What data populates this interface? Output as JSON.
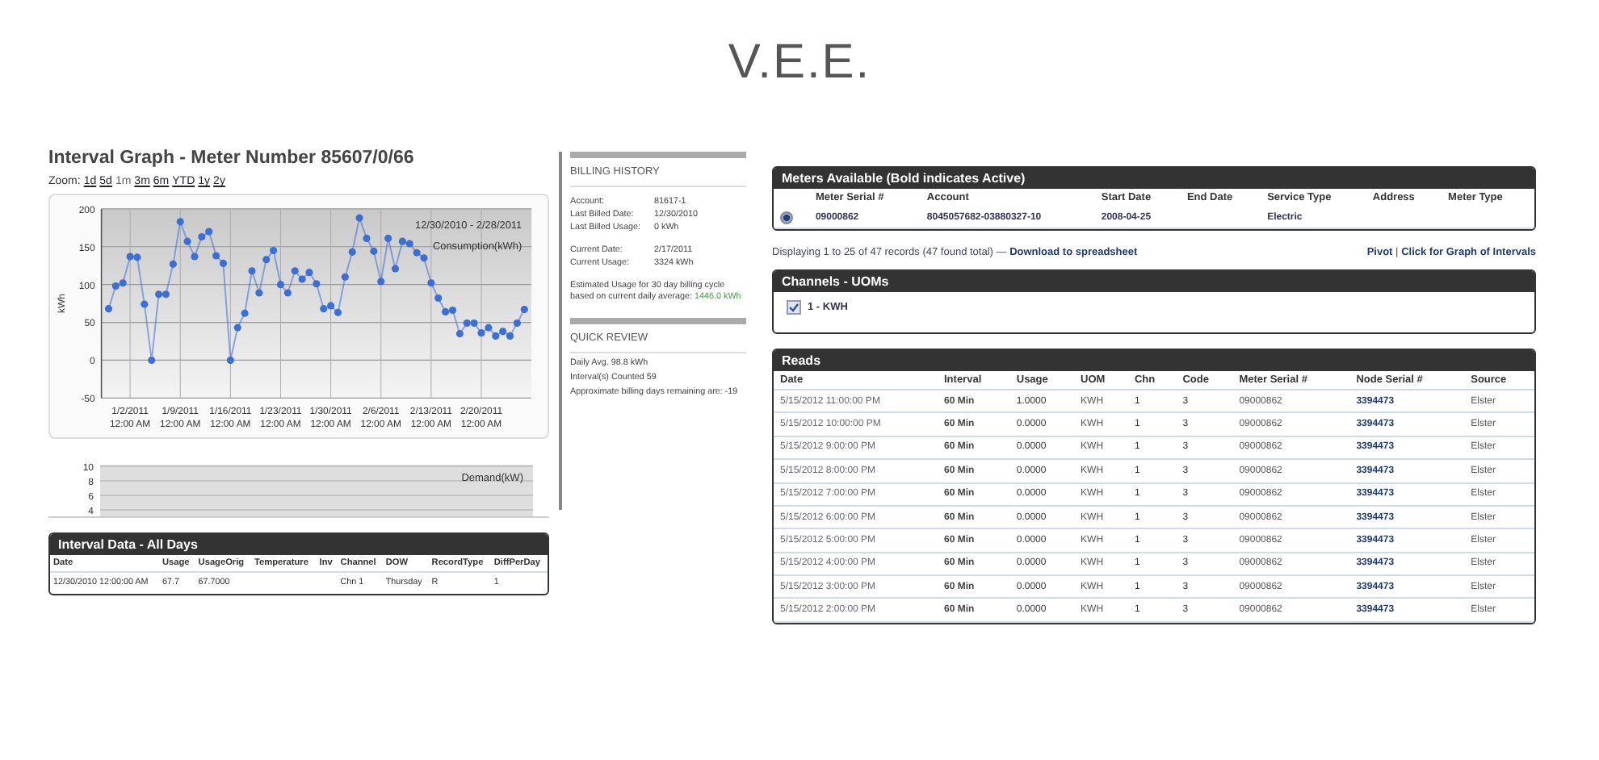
{
  "page_title": "V.E.E.",
  "graph": {
    "title": "Interval Graph - Meter Number 85607/0/66",
    "zoom_label": "Zoom:",
    "zoom_options": [
      {
        "label": "1d",
        "selected": false
      },
      {
        "label": "5d",
        "selected": false
      },
      {
        "label": "1m",
        "selected": true
      },
      {
        "label": "3m",
        "selected": false
      },
      {
        "label": "6m",
        "selected": false
      },
      {
        "label": "YTD",
        "selected": false
      },
      {
        "label": "1y",
        "selected": false
      },
      {
        "label": "2y",
        "selected": false
      }
    ],
    "chart_data": {
      "type": "line",
      "title": "12/30/2010 - 2/28/2011",
      "ylabel": "kWh",
      "grid": true,
      "series": [
        {
          "name": "Consumption(kWh)",
          "color": "#3b6fd6",
          "marker": true,
          "values": [
            68,
            98,
            102,
            137,
            136,
            74,
            0,
            87,
            87,
            127,
            183,
            157,
            137,
            163,
            170,
            138,
            128,
            0,
            43,
            62,
            118,
            89,
            133,
            145,
            100,
            89,
            118,
            107,
            116,
            101,
            68,
            72,
            63,
            110,
            143,
            188,
            161,
            144,
            104,
            161,
            121,
            157,
            154,
            142,
            135,
            102,
            82,
            64,
            66,
            35,
            49,
            49,
            36,
            43,
            32,
            38,
            32,
            49,
            67
          ]
        }
      ],
      "ylim": [
        -50,
        200
      ],
      "yticks": [
        -50,
        0,
        50,
        100,
        150,
        200
      ],
      "categories": [
        null,
        null,
        null,
        "1/2/2011 12:00 AM",
        null,
        null,
        null,
        null,
        null,
        null,
        "1/9/2011 12:00 AM",
        null,
        null,
        null,
        null,
        null,
        null,
        "1/16/2011 12:00 AM",
        null,
        null,
        null,
        null,
        null,
        null,
        "1/23/2011 12:00 AM",
        null,
        null,
        null,
        null,
        null,
        null,
        "1/30/2011 12:00 AM",
        null,
        null,
        null,
        null,
        null,
        null,
        "2/6/2011 12:00 AM",
        null,
        null,
        null,
        null,
        null,
        null,
        "2/13/2011 12:00 AM",
        null,
        null,
        null,
        null,
        null,
        null,
        "2/20/2011 12:00 AM",
        null,
        null,
        null,
        null,
        null,
        null
      ]
    },
    "demand": {
      "legend": "Demand(kW)",
      "ticks": [
        "10",
        "8",
        "6",
        "4"
      ]
    }
  },
  "interval_data": {
    "title": "Interval Data - All Days",
    "columns": [
      "Date",
      "Usage",
      "UsageOrig",
      "Temperature",
      "Inv",
      "Channel",
      "DOW",
      "RecordType",
      "DiffPerDay"
    ],
    "rows": [
      [
        "12/30/2010 12:00:00 AM",
        "67.7",
        "67.7000",
        null,
        null,
        "Chn 1",
        "Thursday",
        "R",
        "1"
      ]
    ]
  },
  "billing": {
    "title": "BILLING HISTORY",
    "groups": [
      [
        {
          "label": "Account:",
          "value": "81617-1"
        },
        {
          "label": "Last Billed Date:",
          "value": "12/30/2010"
        },
        {
          "label": "Last Billed Usage:",
          "value": "0 kWh"
        }
      ],
      [
        {
          "label": "Current Date:",
          "value": "2/17/2011"
        },
        {
          "label": "Current Usage:",
          "value": "3324 kWh"
        }
      ]
    ],
    "estimate_text": "Estimated Usage for 30 day billing cycle based on current daily average:",
    "estimate_value": "1446.0 kWh",
    "review_title": "QUICK REVIEW",
    "review_lines": [
      "Daily Avg. 98.8 kWh",
      "Interval(s) Counted 59",
      "Approximate billing days remaining are: -19"
    ]
  },
  "meters": {
    "title": "Meters Available (Bold indicates Active)",
    "columns": [
      "Meter Serial #",
      "Account",
      "Start Date",
      "End Date",
      "Service Type",
      "Address",
      "Meter Type"
    ],
    "rows": [
      {
        "selected": true,
        "active": true,
        "cells": [
          "09000862",
          "8045057682-03880327-10",
          "2008-04-25",
          null,
          "Electric",
          null,
          null
        ]
      }
    ]
  },
  "records": {
    "summary": "Displaying 1 to 25 of 47 records (47 found total) —",
    "download_link": "Download to spreadsheet",
    "pivot_link": "Pivot",
    "separator": "|",
    "graph_link": "Click for Graph of Intervals"
  },
  "channels": {
    "title": "Channels - UOMs",
    "items": [
      {
        "label": "1 - KWH",
        "checked": true
      }
    ]
  },
  "reads": {
    "title": "Reads",
    "columns": [
      "Date",
      "Interval",
      "Usage",
      "UOM",
      "Chn",
      "Code",
      "Meter Serial #",
      "Node Serial #",
      "Source"
    ],
    "rows": [
      [
        "5/15/2012 11:00:00 PM",
        "60 Min",
        "1.0000",
        "KWH",
        "1",
        "3",
        "09000862",
        "3394473",
        "Elster"
      ],
      [
        "5/15/2012 10:00:00 PM",
        "60 Min",
        "0.0000",
        "KWH",
        "1",
        "3",
        "09000862",
        "3394473",
        "Elster"
      ],
      [
        "5/15/2012 9:00:00 PM",
        "60 Min",
        "0.0000",
        "KWH",
        "1",
        "3",
        "09000862",
        "3394473",
        "Elster"
      ],
      [
        "5/15/2012 8:00:00 PM",
        "60 Min",
        "0.0000",
        "KWH",
        "1",
        "3",
        "09000862",
        "3394473",
        "Elster"
      ],
      [
        "5/15/2012 7:00:00 PM",
        "60 Min",
        "0.0000",
        "KWH",
        "1",
        "3",
        "09000862",
        "3394473",
        "Elster"
      ],
      [
        "5/15/2012 6:00:00 PM",
        "60 Min",
        "0.0000",
        "KWH",
        "1",
        "3",
        "09000862",
        "3394473",
        "Elster"
      ],
      [
        "5/15/2012 5:00:00 PM",
        "60 Min",
        "0.0000",
        "KWH",
        "1",
        "3",
        "09000862",
        "3394473",
        "Elster"
      ],
      [
        "5/15/2012 4:00:00 PM",
        "60 Min",
        "0.0000",
        "KWH",
        "1",
        "3",
        "09000862",
        "3394473",
        "Elster"
      ],
      [
        "5/15/2012 3:00:00 PM",
        "60 Min",
        "0.0000",
        "KWH",
        "1",
        "3",
        "09000862",
        "3394473",
        "Elster"
      ],
      [
        "5/15/2012 2:00:00 PM",
        "60 Min",
        "0.0000",
        "KWH",
        "1",
        "3",
        "09000862",
        "3394473",
        "Elster"
      ]
    ]
  }
}
